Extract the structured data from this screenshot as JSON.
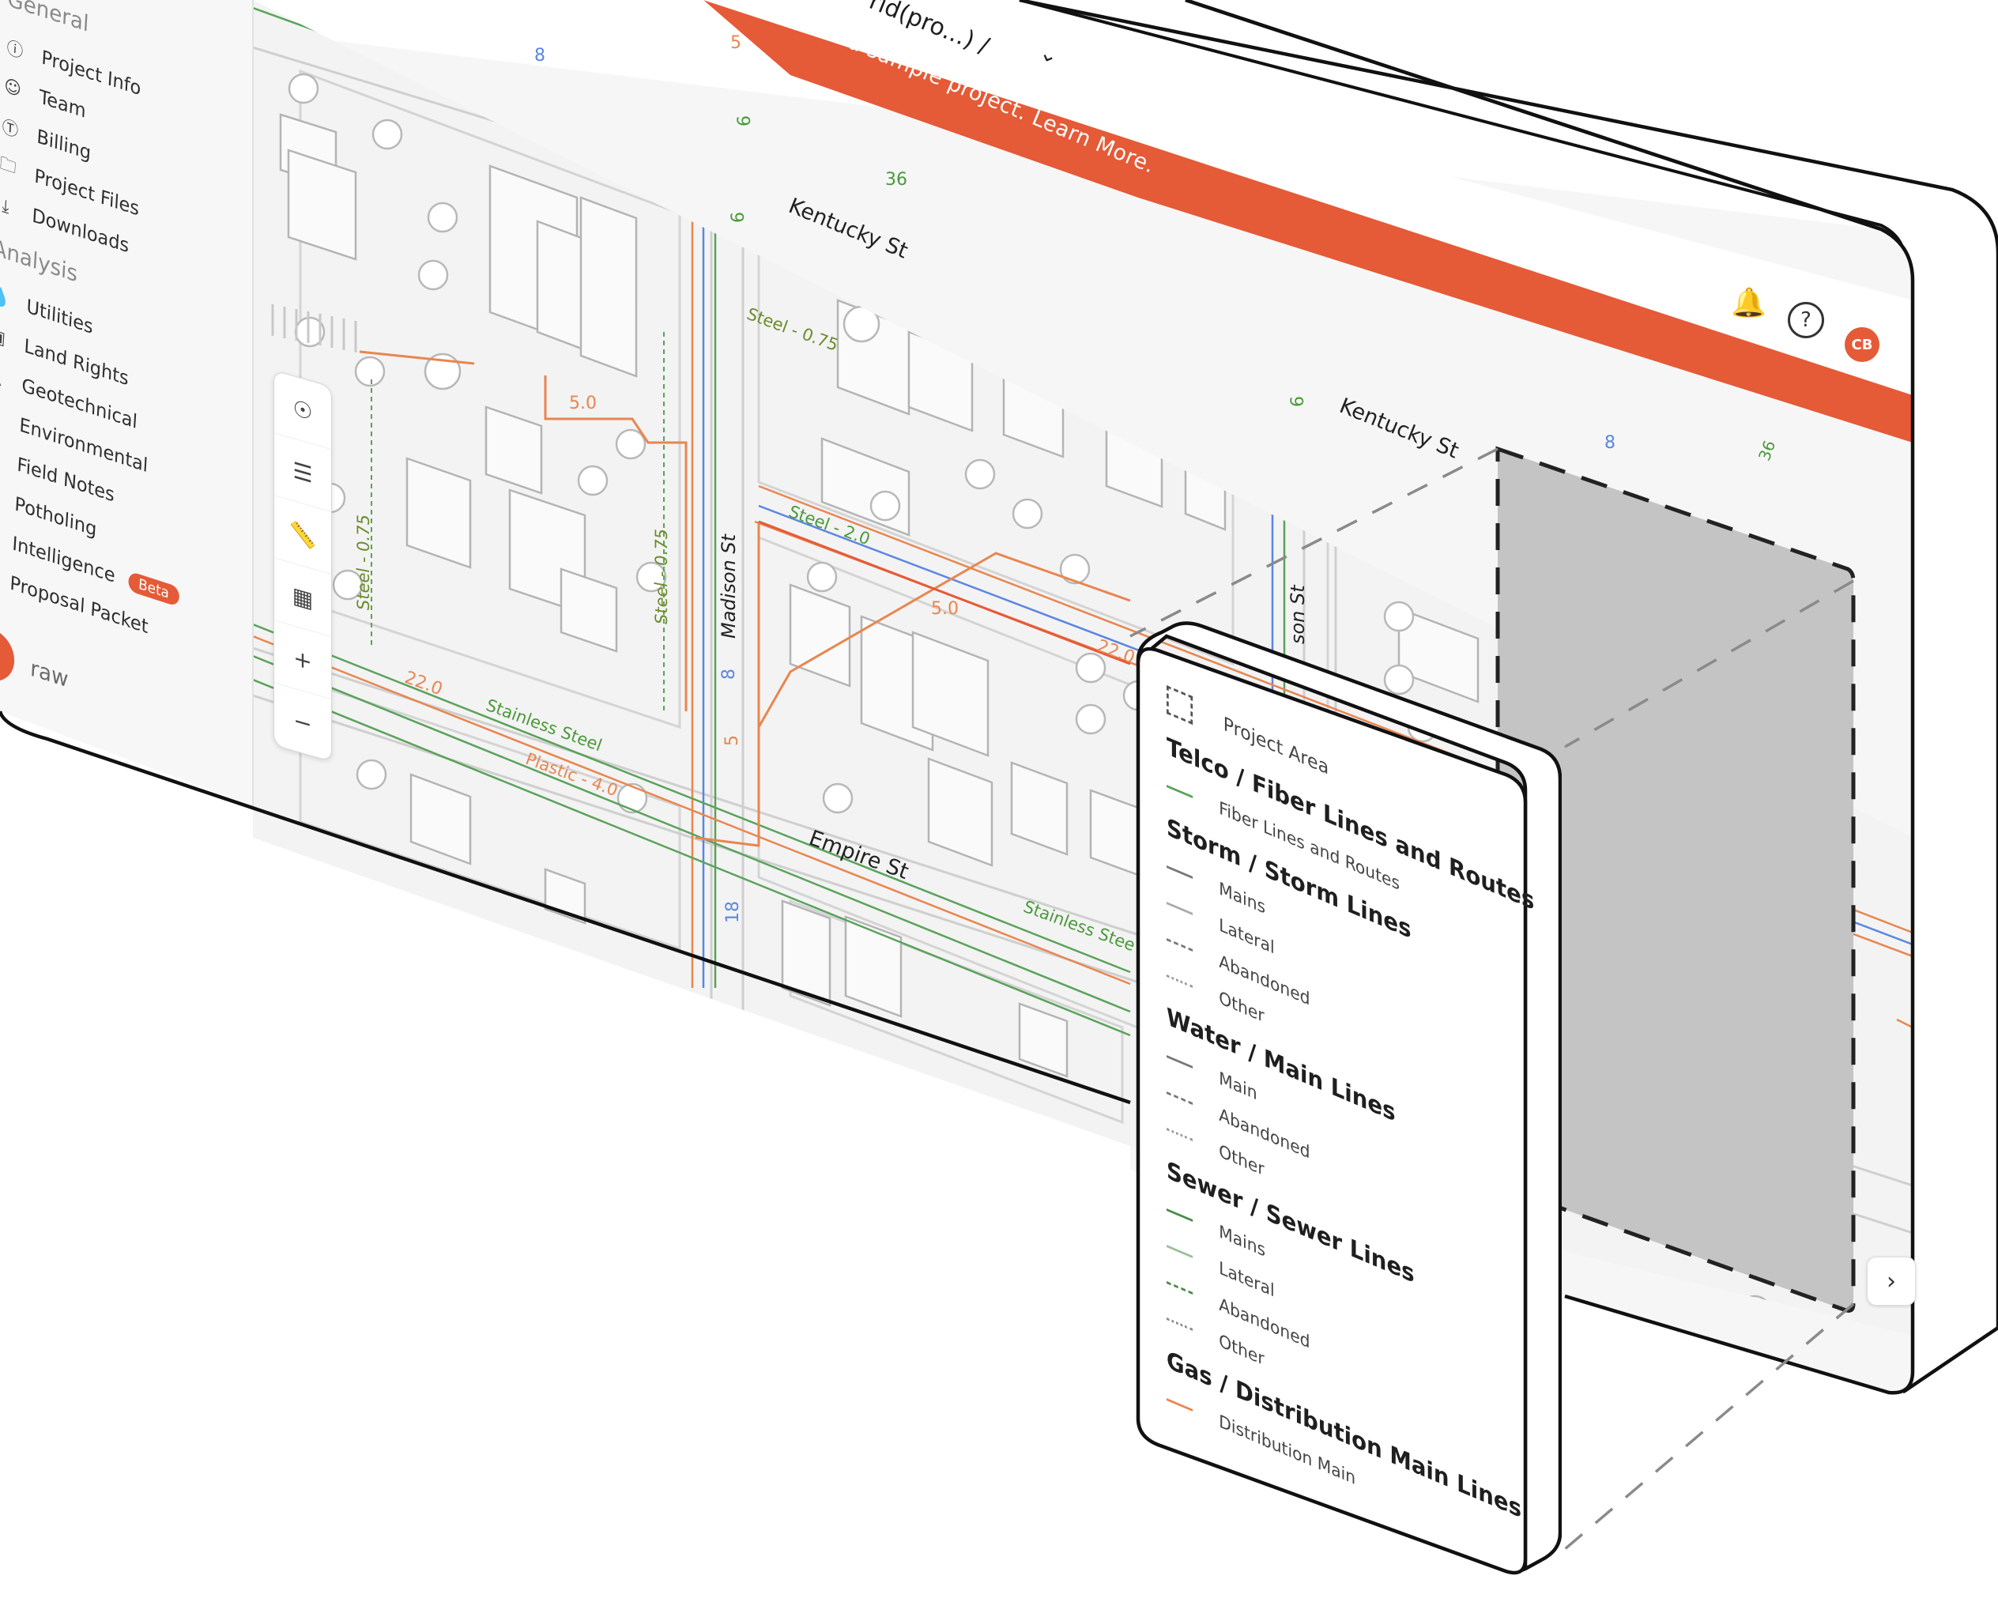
{
  "banner": {
    "breadcrumb": "rid(pro...)  /",
    "message": "This is a sample project. Learn More.",
    "color": "#e55a37"
  },
  "sidebar": {
    "general_label": "General",
    "general_items": [
      {
        "label": "Project Info",
        "icon": "info-icon"
      },
      {
        "label": "Team",
        "icon": "team-icon"
      },
      {
        "label": "Billing",
        "icon": "billing-icon"
      },
      {
        "label": "Project Files",
        "icon": "folder-icon"
      },
      {
        "label": "Downloads",
        "icon": "download-icon"
      }
    ],
    "analysis_label": "Analysis",
    "analysis_items": [
      {
        "label": "Utilities",
        "icon": "utilities-icon"
      },
      {
        "label": "Land Rights",
        "icon": "land-rights-icon"
      },
      {
        "label": "Geotechnical",
        "icon": "geotechnical-icon"
      },
      {
        "label": "Environmental",
        "icon": "environmental-icon"
      },
      {
        "label": "Field Notes",
        "icon": "field-notes-icon"
      },
      {
        "label": "Potholing",
        "icon": "potholing-icon"
      },
      {
        "label": "Intelligence",
        "icon": "intelligence-icon",
        "badge": "Beta"
      },
      {
        "label": "Proposal Packet",
        "icon": "proposal-icon"
      }
    ],
    "brand_name": "raw"
  },
  "header": {
    "avatar_initials": "CB"
  },
  "map": {
    "labels": {
      "kentucky_left": "Kentucky St",
      "kentucky_right": "Kentucky St",
      "madison_left": "Madison St",
      "madison_right": "son St",
      "empire": "Empire St",
      "steel_075_top": "Steel - 0.75",
      "steel_075_left": "Steel - 0.75",
      "steel_075_mid": "Steel - 0.75",
      "steel_20": "Steel - 2.0",
      "stainless_left": "Stainless Steel",
      "stainless_right": "Stainless Stee",
      "plastic": "Plastic - 4.0",
      "n22_left": "22.0",
      "n22_right": "22.0",
      "n50_top": "5.0",
      "n50_mid": "5.0",
      "n5_top": "5",
      "n5_mid": "5",
      "n8_top": "8",
      "n8_right": "8",
      "n8_mid": "8",
      "n36": "36",
      "n6_a": "6",
      "n6_b": "6",
      "n6_c": "6",
      "n18": "18",
      "n36_right": "36"
    }
  },
  "legend": {
    "project_area": "Project Area",
    "groups": [
      {
        "title": "Telco / Fiber Lines and Routes",
        "items": [
          {
            "label": "Fiber Lines and Routes",
            "color": "#5aa25a",
            "style": "solid"
          }
        ]
      },
      {
        "title": "Storm / Storm Lines",
        "items": [
          {
            "label": "Mains",
            "color": "#777777",
            "style": "solid"
          },
          {
            "label": "Lateral",
            "color": "#aaaaaa",
            "style": "solid"
          },
          {
            "label": "Abandoned",
            "color": "#777777",
            "style": "dashed"
          },
          {
            "label": "Other",
            "color": "#999999",
            "style": "dotted"
          }
        ]
      },
      {
        "title": "Water / Main Lines",
        "items": [
          {
            "label": "Main",
            "color": "#777777",
            "style": "solid"
          },
          {
            "label": "Abandoned",
            "color": "#777777",
            "style": "dashed"
          },
          {
            "label": "Other",
            "color": "#999999",
            "style": "dotted"
          }
        ]
      },
      {
        "title": "Sewer / Sewer Lines",
        "items": [
          {
            "label": "Mains",
            "color": "#4a8a4a",
            "style": "solid"
          },
          {
            "label": "Lateral",
            "color": "#9ac09a",
            "style": "solid"
          },
          {
            "label": "Abandoned",
            "color": "#4a8a4a",
            "style": "dashed"
          },
          {
            "label": "Other",
            "color": "#8a8a8a",
            "style": "dotted"
          }
        ]
      },
      {
        "title": "Gas / Distribution Main Lines",
        "items": [
          {
            "label": "Distribution Main",
            "color": "#e8864f",
            "style": "solid"
          }
        ]
      }
    ]
  },
  "colors": {
    "accent": "#e55a37",
    "water_line": "#5b86e0",
    "fiber_line": "#5aa25a",
    "gas_line": "#e8864f",
    "project_area_fill": "#c4c4c4"
  }
}
